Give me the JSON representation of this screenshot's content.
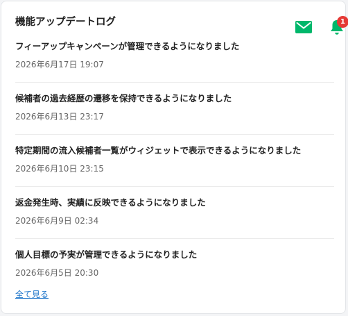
{
  "panel": {
    "title": "機能アップデートログ"
  },
  "notifications": {
    "badge_count": "1",
    "accent_color": "#00b76b",
    "badge_color": "#e53935"
  },
  "updates": [
    {
      "title": "フィーアップキャンペーンが管理できるようになりました",
      "date": "2026年6月17日 19:07"
    },
    {
      "title": "候補者の過去経歴の遷移を保持できるようになりました",
      "date": "2026年6月13日 23:17"
    },
    {
      "title": "特定期間の流入候補者一覧がウィジェットで表示できるようになりました",
      "date": "2026年6月10日 23:15"
    },
    {
      "title": "返金発生時、実績に反映できるようになりました",
      "date": "2026年6月9日 02:34"
    },
    {
      "title": "個人目標の予実が管理できるようになりました",
      "date": "2026年6月5日 20:30"
    }
  ],
  "footer": {
    "see_all_label": "全て見る"
  }
}
